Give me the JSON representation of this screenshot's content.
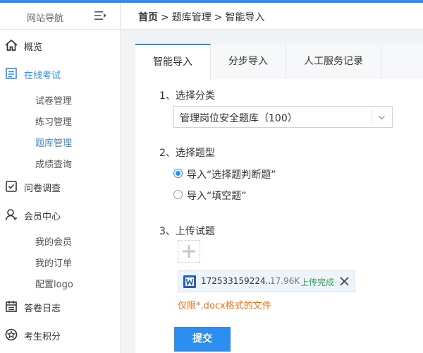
{
  "sidebar": {
    "title": "网站导航",
    "items": [
      {
        "label": "概览",
        "icon": "home-icon"
      },
      {
        "label": "在线考试",
        "icon": "exam-icon",
        "active": true
      },
      {
        "label": "问卷调查",
        "icon": "survey-icon"
      },
      {
        "label": "会员中心",
        "icon": "user-icon"
      },
      {
        "label": "答卷日志",
        "icon": "calendar-icon"
      },
      {
        "label": "考生积分",
        "icon": "points-icon"
      }
    ],
    "exam_sub": [
      "试卷管理",
      "练习管理",
      "题库管理",
      "成绩查询"
    ],
    "member_sub": [
      "我的会员",
      "我的订单",
      "配置logo"
    ]
  },
  "breadcrumb": {
    "home": "首页",
    "sep": ">",
    "level2": "题库管理",
    "level3": "智能导入"
  },
  "tabs": [
    "智能导入",
    "分步导入",
    "人工服务记录"
  ],
  "form": {
    "step1_label": "1、选择分类",
    "category_value": "管理岗位安全题库（100）",
    "step2_label": "2、选择题型",
    "type_options": [
      "导入“选择题判断题”",
      "导入“填空题”"
    ],
    "step3_label": "3、上传试题",
    "file": {
      "name": "172533159224...",
      "size": "17.96K",
      "status": "上传完成"
    },
    "hint": "仅限*.docx格式的文件",
    "submit_label": "提交"
  },
  "colors": {
    "accent": "#2b8ef0",
    "success": "#2fa14a",
    "warning": "#f2711c"
  }
}
